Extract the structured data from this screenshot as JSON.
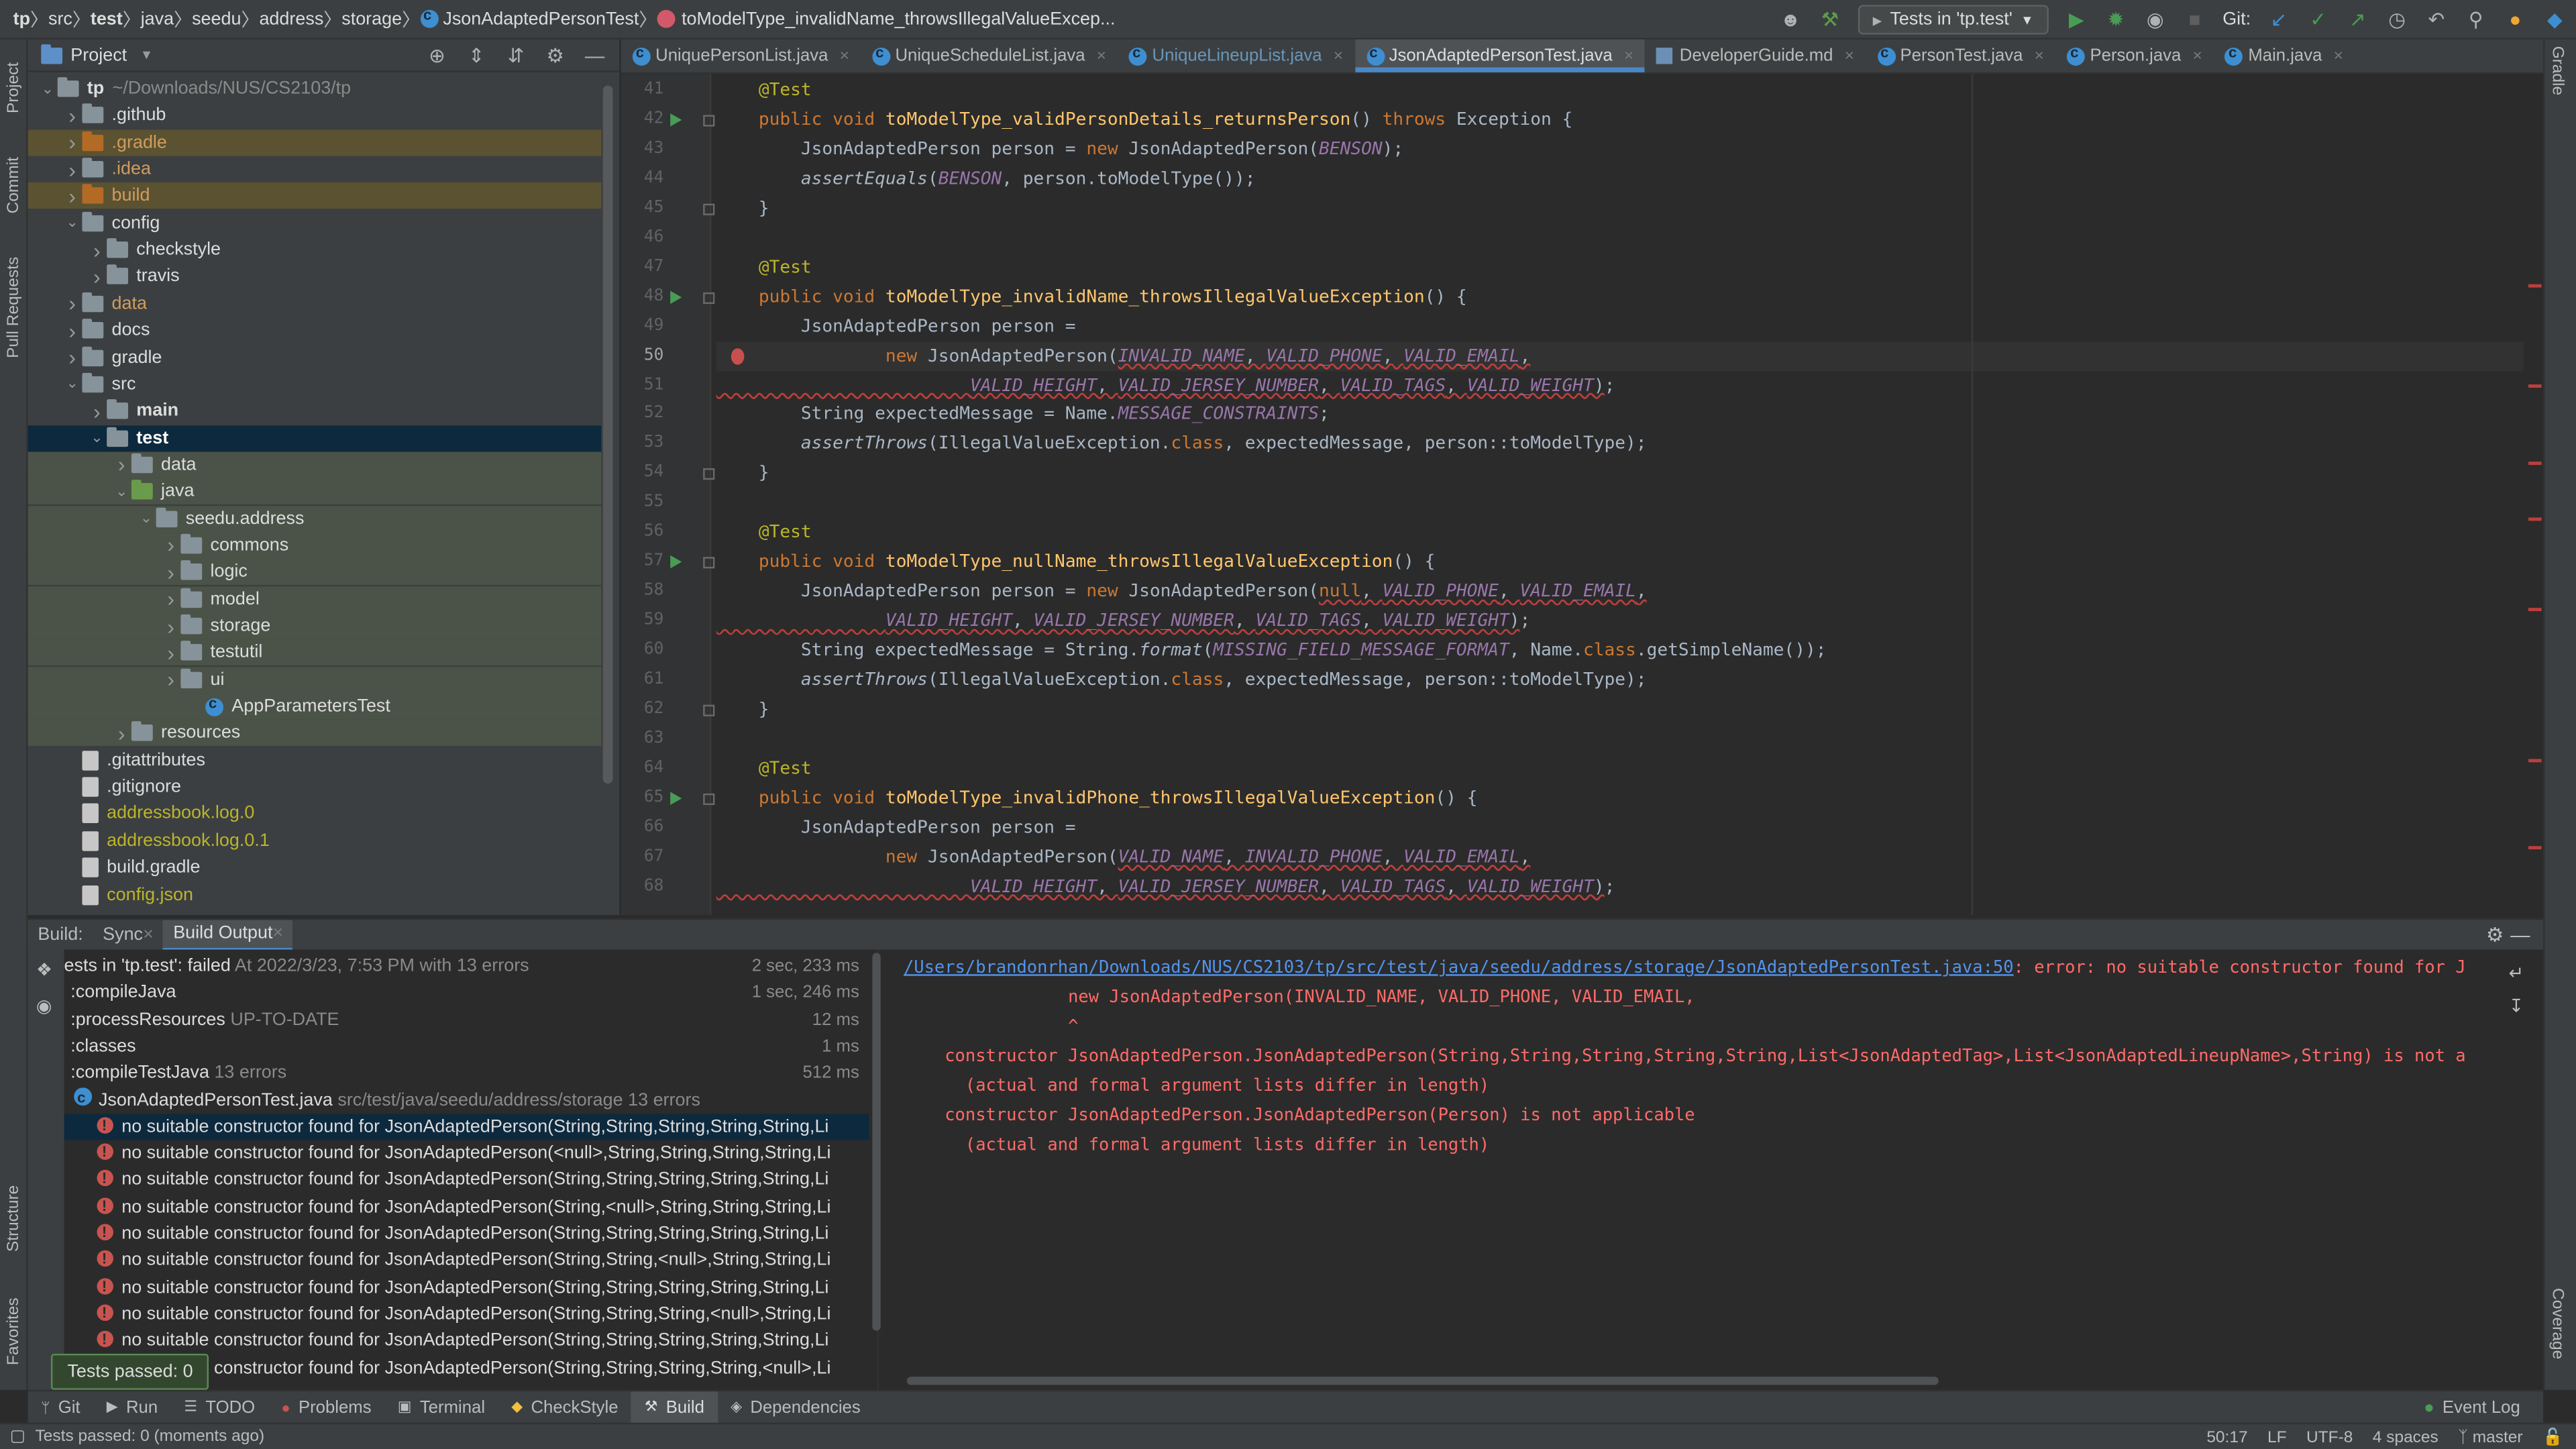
{
  "breadcrumbs": [
    "tp",
    "src",
    "test",
    "java",
    "seedu",
    "address",
    "storage",
    "JsonAdaptedPersonTest",
    "toModelType_invalidName_throwsIllegalValueExcep..."
  ],
  "run_config": "Tests in 'tp.test'",
  "git_label": "Git:",
  "left_strip": [
    "Project",
    "Commit",
    "Pull Requests",
    "Structure",
    "Favorites"
  ],
  "right_strip": [
    "Gradle",
    "Coverage"
  ],
  "project_panel": {
    "title": "Project"
  },
  "tree": [
    {
      "label": "tp",
      "extra": "~/Downloads/NUS/CS2103/tp",
      "depth": 0,
      "arrow": "open",
      "icon": "folder",
      "bold": true,
      "color": "#dcdcdc"
    },
    {
      "label": ".github",
      "depth": 1,
      "arrow": "closed",
      "icon": "folder",
      "color": "#dcdcdc"
    },
    {
      "label": ".gradle",
      "depth": 1,
      "arrow": "closed",
      "icon": "folder-orange",
      "color": "#d09d5d",
      "bg": "gb"
    },
    {
      "label": ".idea",
      "depth": 1,
      "arrow": "closed",
      "icon": "folder",
      "color": "#d09d5d"
    },
    {
      "label": "build",
      "depth": 1,
      "arrow": "closed",
      "icon": "folder-orange",
      "color": "#d09d5d",
      "bg": "gb"
    },
    {
      "label": "config",
      "depth": 1,
      "arrow": "open",
      "icon": "folder",
      "color": "#dcdcdc"
    },
    {
      "label": "checkstyle",
      "depth": 2,
      "arrow": "closed",
      "icon": "folder",
      "color": "#dcdcdc"
    },
    {
      "label": "travis",
      "depth": 2,
      "arrow": "closed",
      "icon": "folder",
      "color": "#dcdcdc"
    },
    {
      "label": "data",
      "depth": 1,
      "arrow": "closed",
      "icon": "folder",
      "color": "#d09d5d"
    },
    {
      "label": "docs",
      "depth": 1,
      "arrow": "closed",
      "icon": "folder",
      "color": "#dcdcdc"
    },
    {
      "label": "gradle",
      "depth": 1,
      "arrow": "closed",
      "icon": "folder",
      "color": "#dcdcdc"
    },
    {
      "label": "src",
      "depth": 1,
      "arrow": "open",
      "icon": "folder",
      "color": "#dcdcdc"
    },
    {
      "label": "main",
      "depth": 2,
      "arrow": "closed",
      "icon": "folder",
      "bold": true,
      "color": "#dcdcdc"
    },
    {
      "label": "test",
      "depth": 2,
      "arrow": "open",
      "icon": "folder",
      "bold": true,
      "color": "#ffffff",
      "bg": "sel"
    },
    {
      "label": "data",
      "depth": 3,
      "arrow": "closed",
      "icon": "folder",
      "color": "#dcdcdc",
      "bg": "gr"
    },
    {
      "label": "java",
      "depth": 3,
      "arrow": "open",
      "icon": "folder-green",
      "color": "#dcdcdc",
      "bg": "gr"
    },
    {
      "label": "seedu.address",
      "depth": 4,
      "arrow": "open",
      "icon": "folder",
      "color": "#dcdcdc",
      "bg": "gr"
    },
    {
      "label": "commons",
      "depth": 5,
      "arrow": "closed",
      "icon": "folder",
      "color": "#dcdcdc",
      "bg": "gr"
    },
    {
      "label": "logic",
      "depth": 5,
      "arrow": "closed",
      "icon": "folder",
      "color": "#dcdcdc",
      "bg": "gr"
    },
    {
      "label": "model",
      "depth": 5,
      "arrow": "closed",
      "icon": "folder",
      "color": "#dcdcdc",
      "bg": "gr"
    },
    {
      "label": "storage",
      "depth": 5,
      "arrow": "closed",
      "icon": "folder",
      "color": "#dcdcdc",
      "bg": "gr"
    },
    {
      "label": "testutil",
      "depth": 5,
      "arrow": "closed",
      "icon": "folder",
      "color": "#dcdcdc",
      "bg": "gr"
    },
    {
      "label": "ui",
      "depth": 5,
      "arrow": "closed",
      "icon": "folder",
      "color": "#dcdcdc",
      "bg": "gr"
    },
    {
      "label": "AppParametersTest",
      "depth": 6,
      "arrow": "none",
      "icon": "class",
      "color": "#dcdcdc",
      "bg": "gr"
    },
    {
      "label": "resources",
      "depth": 3,
      "arrow": "closed",
      "icon": "folder",
      "color": "#dcdcdc",
      "bg": "gr"
    },
    {
      "label": ".gitattributes",
      "depth": 1,
      "arrow": "none",
      "icon": "file",
      "color": "#dcdcdc"
    },
    {
      "label": ".gitignore",
      "depth": 1,
      "arrow": "none",
      "icon": "file",
      "color": "#dcdcdc"
    },
    {
      "label": "addressbook.log.0",
      "depth": 1,
      "arrow": "none",
      "icon": "file",
      "color": "#bbb529"
    },
    {
      "label": "addressbook.log.0.1",
      "depth": 1,
      "arrow": "none",
      "icon": "file",
      "color": "#bbb529"
    },
    {
      "label": "build.gradle",
      "depth": 1,
      "arrow": "none",
      "icon": "file",
      "color": "#dcdcdc"
    },
    {
      "label": "config.json",
      "depth": 1,
      "arrow": "none",
      "icon": "file",
      "color": "#bbb529"
    }
  ],
  "tabs": [
    {
      "label": "UniquePersonList.java",
      "style": ""
    },
    {
      "label": "UniqueScheduleList.java",
      "style": ""
    },
    {
      "label": "UniqueLineupList.java",
      "style": "modified"
    },
    {
      "label": "JsonAdaptedPersonTest.java",
      "style": "active"
    },
    {
      "label": "DeveloperGuide.md",
      "style": "md"
    },
    {
      "label": "PersonTest.java",
      "style": ""
    },
    {
      "label": "Person.java",
      "style": ""
    },
    {
      "label": "Main.java",
      "style": ""
    }
  ],
  "error_count": "13",
  "editor_lines": [
    {
      "n": "41",
      "html": "    <span class=\"an\">@Test</span>"
    },
    {
      "n": "42",
      "run": true,
      "fold": true,
      "html": "    <span class=\"k\">public void </span><span class=\"fn\">toModelType_validPersonDetails_returnsPerson</span>() <span class=\"k\">throws </span>Exception {"
    },
    {
      "n": "43",
      "html": "        JsonAdaptedPerson person = <span class=\"k\">new </span>JsonAdaptedPerson(<span class=\"cst\">BENSON</span>);"
    },
    {
      "n": "44",
      "html": "        <span class=\"it\">assertEquals</span>(<span class=\"cst\">BENSON</span>, person.toModelType());"
    },
    {
      "n": "45",
      "fold": true,
      "html": "    }"
    },
    {
      "n": "46",
      "html": ""
    },
    {
      "n": "47",
      "html": "    <span class=\"an\">@Test</span>"
    },
    {
      "n": "48",
      "run": true,
      "fold": true,
      "html": "    <span class=\"k\">public void </span><span class=\"fn\">toModelType_invalidName_throwsIllegalValueException</span>() {"
    },
    {
      "n": "49",
      "html": "        JsonAdaptedPerson person ="
    },
    {
      "n": "50",
      "cur": true,
      "bulb": true,
      "html": "                <span class=\"k\">new </span>JsonAdaptedPerson(<span class=\"err\"><span class=\"cst\">INVALID_NAME</span>, <span class=\"cst\">VALID_PHONE</span>, <span class=\"cst\">VALID_EMAIL</span>,</span>"
    },
    {
      "n": "51",
      "html": "<span class=\"err\">                        <span class=\"cst\">VALID_HEIGHT</span>, <span class=\"cst\">VALID_JERSEY_NUMBER</span>, <span class=\"cst\">VALID_TAGS</span>, <span class=\"cst\">VALID_WEIGHT</span>)</span>;"
    },
    {
      "n": "52",
      "html": "        String expectedMessage = Name.<span class=\"cst\">MESSAGE_CONSTRAINTS</span>;"
    },
    {
      "n": "53",
      "html": "        <span class=\"it\">assertThrows</span>(IllegalValueException.<span class=\"k\">class</span>, expectedMessage, person::toModelType);"
    },
    {
      "n": "54",
      "fold": true,
      "html": "    }"
    },
    {
      "n": "55",
      "html": ""
    },
    {
      "n": "56",
      "html": "    <span class=\"an\">@Test</span>"
    },
    {
      "n": "57",
      "run": true,
      "fold": true,
      "html": "    <span class=\"k\">public void </span><span class=\"fn\">toModelType_nullName_throwsIllegalValueException</span>() {"
    },
    {
      "n": "58",
      "html": "        JsonAdaptedPerson person = <span class=\"k\">new </span>JsonAdaptedPerson(<span class=\"err\"><span class=\"k\">null</span>, <span class=\"cst\">VALID_PHONE</span>, <span class=\"cst\">VALID_EMAIL</span>,</span>"
    },
    {
      "n": "59",
      "html": "<span class=\"err\">                <span class=\"cst\">VALID_HEIGHT</span>, <span class=\"cst\">VALID_JERSEY_NUMBER</span>, <span class=\"cst\">VALID_TAGS</span>, <span class=\"cst\">VALID_WEIGHT</span>)</span>;"
    },
    {
      "n": "60",
      "html": "        String expectedMessage = String.<span class=\"it\">format</span>(<span class=\"cst\">MISSING_FIELD_MESSAGE_FORMAT</span>, Name.<span class=\"k\">class</span>.getSimpleName());"
    },
    {
      "n": "61",
      "html": "        <span class=\"it\">assertThrows</span>(IllegalValueException.<span class=\"k\">class</span>, expectedMessage, person::toModelType);"
    },
    {
      "n": "62",
      "fold": true,
      "html": "    }"
    },
    {
      "n": "63",
      "html": ""
    },
    {
      "n": "64",
      "html": "    <span class=\"an\">@Test</span>"
    },
    {
      "n": "65",
      "run": true,
      "fold": true,
      "html": "    <span class=\"k\">public void </span><span class=\"fn\">toModelType_invalidPhone_throwsIllegalValueException</span>() {"
    },
    {
      "n": "66",
      "html": "        JsonAdaptedPerson person ="
    },
    {
      "n": "67",
      "html": "                <span class=\"k\">new </span>JsonAdaptedPerson(<span class=\"err\"><span class=\"cst\">VALID_NAME</span>, <span class=\"cst\">INVALID_PHONE</span>, <span class=\"cst\">VALID_EMAIL</span>,</span>"
    },
    {
      "n": "68",
      "html": "<span class=\"err\">                        <span class=\"cst\">VALID_HEIGHT</span>, <span class=\"cst\">VALID_JERSEY_NUMBER</span>, <span class=\"cst\">VALID_TAGS</span>, <span class=\"cst\">VALID_WEIGHT</span>)</span>;"
    }
  ],
  "build": {
    "label": "Build:",
    "tabs": [
      {
        "label": "Sync"
      },
      {
        "label": "Build Output"
      }
    ],
    "tree": [
      {
        "text": "ests in 'tp.test': failed",
        "dim": " At 2022/3/23, 7:53 PM with 13 errors",
        "time": "2 sec, 233 ms",
        "indent": 0,
        "bold": true
      },
      {
        "text": ":compileJava",
        "time": "1 sec, 246 ms",
        "indent": 1
      },
      {
        "text": ":processResources",
        "dim": " UP-TO-DATE",
        "time": "12 ms",
        "indent": 1
      },
      {
        "text": ":classes",
        "time": "1 ms",
        "indent": 1
      },
      {
        "text": ":compileTestJava",
        "dim": "  13 errors",
        "time": "512 ms",
        "indent": 1
      },
      {
        "text": "JsonAdaptedPersonTest.java",
        "dim": " src/test/java/seedu/address/storage 13 errors",
        "indent": 2,
        "file": true
      },
      {
        "text": "no suitable constructor found for JsonAdaptedPerson(String,String,String,String,String,Li",
        "indent": 3,
        "err": true,
        "sel": true
      },
      {
        "text": "no suitable constructor found for JsonAdaptedPerson(<null>,String,String,String,String,Li",
        "indent": 3,
        "err": true
      },
      {
        "text": "no suitable constructor found for JsonAdaptedPerson(String,String,String,String,String,Li",
        "indent": 3,
        "err": true
      },
      {
        "text": "no suitable constructor found for JsonAdaptedPerson(String,<null>,String,String,String,Li",
        "indent": 3,
        "err": true
      },
      {
        "text": "no suitable constructor found for JsonAdaptedPerson(String,String,String,String,String,Li",
        "indent": 3,
        "err": true
      },
      {
        "text": "no suitable constructor found for JsonAdaptedPerson(String,String,<null>,String,String,Li",
        "indent": 3,
        "err": true
      },
      {
        "text": "no suitable constructor found for JsonAdaptedPerson(String,String,String,String,String,Li",
        "indent": 3,
        "err": true
      },
      {
        "text": "no suitable constructor found for JsonAdaptedPerson(String,String,String,<null>,String,Li",
        "indent": 3,
        "err": true
      },
      {
        "text": "no suitable constructor found for JsonAdaptedPerson(String,String,String,String,String,Li",
        "indent": 3,
        "err": true
      },
      {
        "text": "no suitable constructor found for JsonAdaptedPerson(String,String,String,String,<null>,Li",
        "indent": 3,
        "err": true
      }
    ],
    "output": [
      {
        "link": "/Users/brandonrhan/Downloads/NUS/CS2103/tp/src/test/java/seedu/address/storage/JsonAdaptedPersonTest.java:50",
        "text": ": error: no suitable constructor found for J"
      },
      {
        "text": "                new JsonAdaptedPerson(INVALID_NAME, VALID_PHONE, VALID_EMAIL,"
      },
      {
        "text": "                ^"
      },
      {
        "text": "    constructor JsonAdaptedPerson.JsonAdaptedPerson(String,String,String,String,String,List<JsonAdaptedTag>,List<JsonAdaptedLineupName>,String) is not a"
      },
      {
        "text": "      (actual and formal argument lists differ in length)"
      },
      {
        "text": "    constructor JsonAdaptedPerson.JsonAdaptedPerson(Person) is not applicable"
      },
      {
        "text": "      (actual and formal argument lists differ in length)"
      }
    ],
    "tooltip": "Tests passed: 0"
  },
  "bottom_tools": [
    {
      "label": "Git",
      "icon": "git-branch-icon"
    },
    {
      "label": "Run",
      "icon": "play-icon"
    },
    {
      "label": "TODO",
      "icon": "list-icon"
    },
    {
      "label": "Problems",
      "icon": "error-circle-icon"
    },
    {
      "label": "Terminal",
      "icon": "terminal-icon"
    },
    {
      "label": "CheckStyle",
      "icon": "checkstyle-icon"
    },
    {
      "label": "Build",
      "icon": "hammer-icon",
      "active": true
    },
    {
      "label": "Dependencies",
      "icon": "layers-icon"
    }
  ],
  "event_log": "Event Log",
  "status": {
    "message": "Tests passed: 0 (moments ago)",
    "position": "50:17",
    "line_sep": "LF",
    "encoding": "UTF-8",
    "indent": "4 spaces",
    "branch": "master"
  },
  "colors": {
    "accent": "#4a88c7",
    "error": "#c75450",
    "run": "#499c54"
  }
}
